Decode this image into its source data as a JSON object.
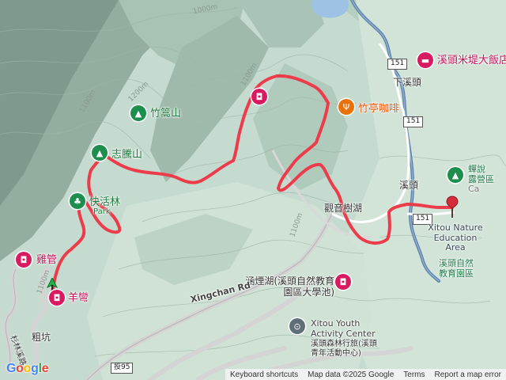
{
  "map": {
    "peaks": [
      {
        "name": "竹篙山"
      },
      {
        "name": "志騰山"
      },
      {
        "name": "快活林",
        "sub": "Park"
      }
    ],
    "places": [
      {
        "name": "竹亭咖啡"
      },
      {
        "name": "溪頭米堤大飯店"
      },
      {
        "name": "雞管"
      },
      {
        "name": "羊彎"
      },
      {
        "name": "蟬說",
        "sub": "露營區",
        "extra": "Ca"
      }
    ],
    "towns": [
      {
        "name": "下溪頭"
      },
      {
        "name": "溪頭"
      },
      {
        "name": "粗坑"
      },
      {
        "name": "觀音樹湖"
      }
    ],
    "areas": [
      {
        "en": "Xitou Nature Education Area",
        "zh": "溪頭自然教育園區"
      },
      {
        "zh": "涵煙湖(溪頭自然教育園區大學池)"
      },
      {
        "en": "Xitou Youth Activity Center",
        "zh": "溪頭森林行旅(溪頭青年活動中心)"
      }
    ],
    "roads": [
      {
        "name": "Xingchan Rd"
      },
      {
        "name": "杉林溪路"
      }
    ],
    "shields": [
      "151",
      "151",
      "151",
      "投95"
    ],
    "contours": [
      "1000m",
      "1100m",
      "1200m",
      "1100m",
      "1100m",
      "1100m"
    ]
  },
  "footer": {
    "keyboard": "Keyboard shortcuts",
    "mapdata": "Map data ©2025 Google",
    "terms": "Terms",
    "report": "Report a map error"
  },
  "logo": "Google",
  "colors": {
    "track": "#ec3b4a",
    "river": "#5b7fa6",
    "road": "#c9c9c9",
    "terrain": "#b9d3c6"
  }
}
